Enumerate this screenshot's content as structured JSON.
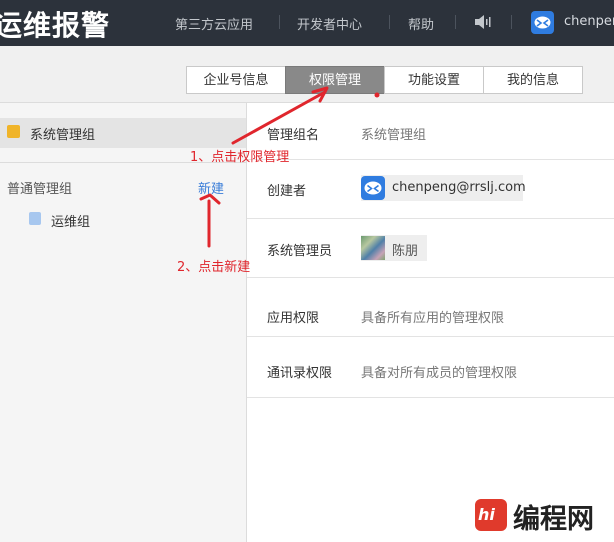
{
  "header": {
    "app_title": "运维报警",
    "nav": [
      "第三方云应用",
      "开发者中心",
      "帮助"
    ],
    "speaker_icon": "speaker-icon",
    "user_name": "chenpeng",
    "bg_color": "#2c323b"
  },
  "tabs": [
    {
      "label": "企业号信息",
      "active": false
    },
    {
      "label": "权限管理",
      "active": true
    },
    {
      "label": "功能设置",
      "active": false
    },
    {
      "label": "我的信息",
      "active": false
    }
  ],
  "sidebar": {
    "system_group": "系统管理组",
    "normal_group": "普通管理组",
    "new_link": "新建",
    "ops_group": "运维组"
  },
  "detail": {
    "group_name_label": "管理组名",
    "group_name_value": "系统管理组",
    "creator_label": "创建者",
    "creator_value": "chenpeng@rrslj.com",
    "admin_label": "系统管理员",
    "admin_value": "陈朋",
    "app_perm_label": "应用权限",
    "app_perm_value": "具备所有应用的管理权限",
    "contacts_perm_label": "通讯录权限",
    "contacts_perm_value": "具备对所有成员的管理权限"
  },
  "annotations": {
    "step1": "1、点击权限管理",
    "step2": "2、点击新建",
    "color": "#e0262d"
  },
  "watermark": {
    "logo": "hi",
    "text": "编程网"
  }
}
